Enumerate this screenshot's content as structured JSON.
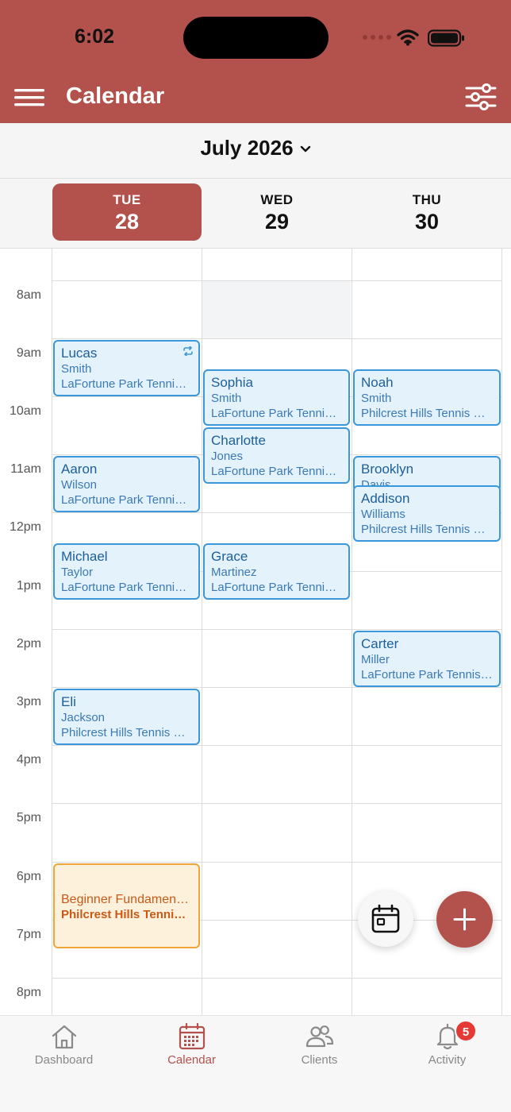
{
  "status_bar": {
    "time": "6:02"
  },
  "header": {
    "title": "Calendar"
  },
  "month_selector": {
    "label": "July 2026"
  },
  "days": [
    {
      "dow": "TUE",
      "num": "28",
      "selected": true
    },
    {
      "dow": "WED",
      "num": "29",
      "selected": false
    },
    {
      "dow": "THU",
      "num": "30",
      "selected": false
    }
  ],
  "time_labels": [
    "8am",
    "9am",
    "10am",
    "11am",
    "12pm",
    "1pm",
    "2pm",
    "3pm",
    "4pm",
    "5pm",
    "6pm",
    "7pm",
    "8pm"
  ],
  "events": [
    {
      "first": "Lucas",
      "last": "Smith",
      "location": "LaFortune Park Tennis Center",
      "recurring": true
    },
    {
      "first": "Aaron",
      "last": "Wilson",
      "location": "LaFortune Park Tennis Center"
    },
    {
      "first": "Michael",
      "last": "Taylor",
      "location": "LaFortune Park Tennis Center"
    },
    {
      "first": "Eli",
      "last": "Jackson",
      "location": "Philcrest Hills Tennis Center"
    },
    {
      "first": "Sophia",
      "last": "Smith",
      "location": "LaFortune Park Tennis Center"
    },
    {
      "first": "Charlotte",
      "last": "Jones",
      "location": "LaFortune Park Tennis Center"
    },
    {
      "first": "Grace",
      "last": "Martinez",
      "location": "LaFortune Park Tennis Center"
    },
    {
      "first": "Noah",
      "last": "Smith",
      "location": "Philcrest Hills Tennis Center"
    },
    {
      "first": "Brooklyn",
      "last": "Davis",
      "location": ""
    },
    {
      "first": "Addison",
      "last": "Williams",
      "location": "Philcrest Hills Tennis Center"
    },
    {
      "first": "Carter",
      "last": "Miller",
      "location": "LaFortune Park Tennis Center"
    }
  ],
  "class_event": {
    "title": "Beginner Fundamentals",
    "location": "Philcrest Hills Tennis Center"
  },
  "tabs": [
    {
      "label": "Dashboard",
      "icon": "home-icon"
    },
    {
      "label": "Calendar",
      "icon": "calendar-icon"
    },
    {
      "label": "Clients",
      "icon": "users-icon"
    },
    {
      "label": "Activity",
      "icon": "bell-icon"
    }
  ],
  "activity_badge": "5",
  "colors": {
    "brand": "#b3514d",
    "event_border": "#3b97dc",
    "event_fill": "#e4f2fc",
    "class_border": "#f0a53a",
    "badge": "#e53935"
  }
}
